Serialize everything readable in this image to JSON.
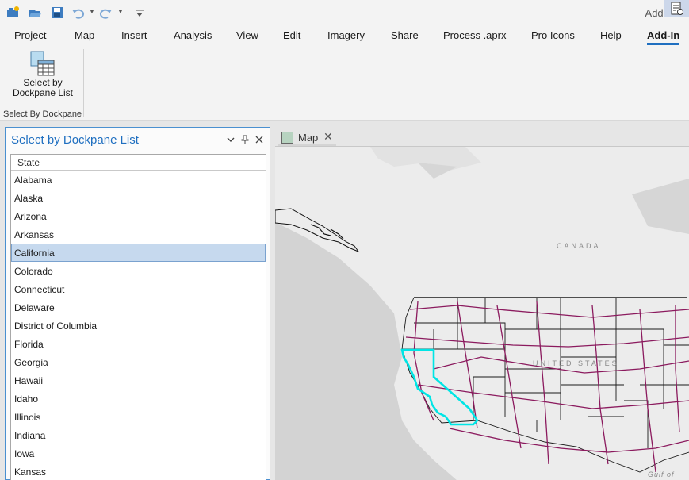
{
  "quick_access": {
    "items": [
      "new-project-icon",
      "open-project-icon",
      "save-project-icon",
      "undo-icon",
      "redo-icon",
      "customize-icon"
    ],
    "corner_fragment": "Add-"
  },
  "ribbon": {
    "tabs": [
      "Project",
      "Map",
      "Insert",
      "Analysis",
      "View",
      "Edit",
      "Imagery",
      "Share",
      "Process .aprx",
      "Pro Icons",
      "Help",
      "Add-In"
    ],
    "active_tab": "Add-In",
    "button": {
      "label_line1": "Select by",
      "label_line2": "Dockpane List",
      "icon": "select-by-list-icon"
    },
    "group_label": "Select By Dockpane"
  },
  "dockpane": {
    "title": "Select by Dockpane List",
    "controls": [
      "options-chevron-icon",
      "pin-icon",
      "close-icon"
    ],
    "column_header": "State",
    "items": [
      "Alabama",
      "Alaska",
      "Arizona",
      "Arkansas",
      "California",
      "Colorado",
      "Connecticut",
      "Delaware",
      "District of Columbia",
      "Florida",
      "Georgia",
      "Hawaii",
      "Idaho",
      "Illinois",
      "Indiana",
      "Iowa",
      "Kansas"
    ],
    "selected": "California"
  },
  "map_view": {
    "tab_label": "Map",
    "labels": {
      "canada": "CANADA",
      "united_states": "UNITED STATES",
      "gulf": "Gulf of"
    },
    "colors": {
      "highways": "#8b1a5e",
      "selection": "#00e5e5",
      "water": "#d2d2d2",
      "land": "#ececec",
      "borders": "#1a1a1a"
    }
  }
}
